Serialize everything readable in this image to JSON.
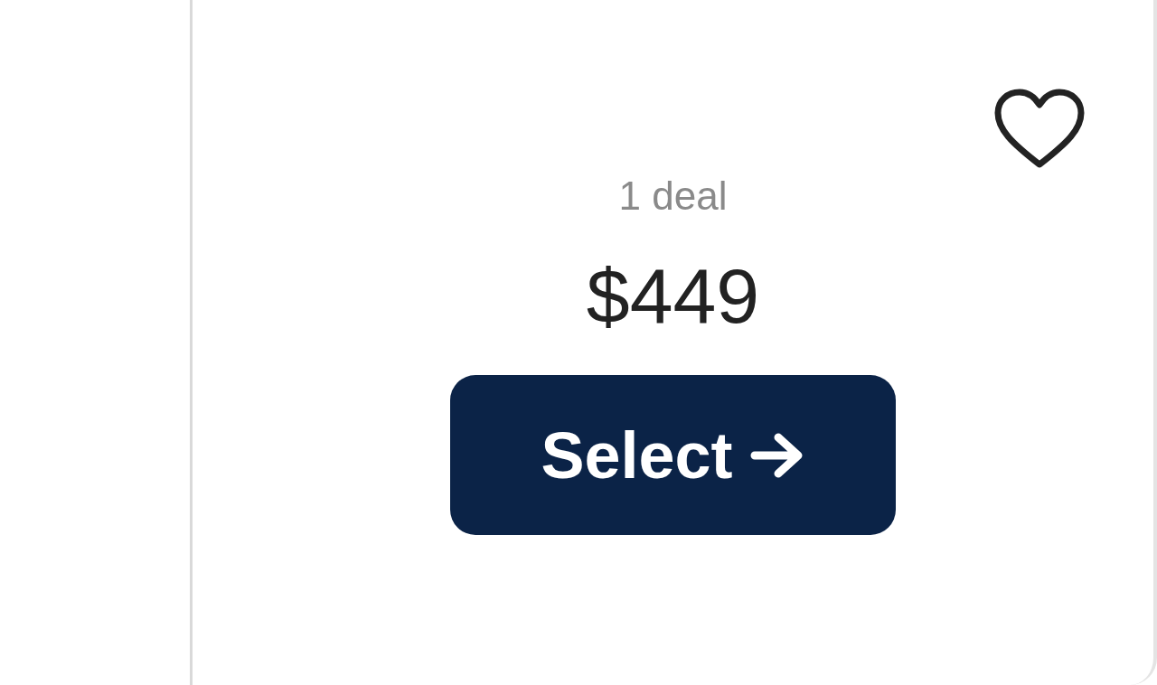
{
  "offer": {
    "favorited": false,
    "deal_count": "1 deal",
    "price": "$449",
    "button": "Select"
  }
}
